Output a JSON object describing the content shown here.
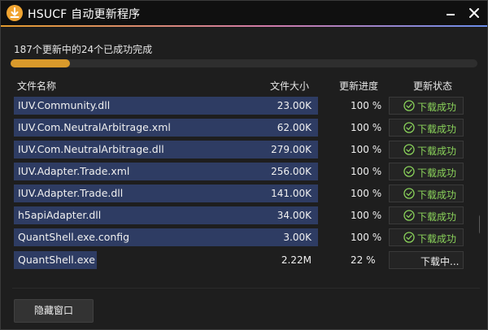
{
  "window": {
    "title": "HSUCF 自动更新程序"
  },
  "summary": {
    "text": "187个更新中的24个已成功完成",
    "progress_fraction": 0.128
  },
  "table": {
    "columns": [
      "文件名称",
      "文件大小",
      "更新进度",
      "更新状态"
    ],
    "rows": [
      {
        "name": "IUV.Community.dll",
        "size": "23.00K",
        "progress": "100 %",
        "status": "下载成功",
        "done": true
      },
      {
        "name": "IUV.Com.NeutralArbitrage.xml",
        "size": "62.00K",
        "progress": "100 %",
        "status": "下载成功",
        "done": true
      },
      {
        "name": "IUV.Com.NeutralArbitrage.dll",
        "size": "279.00K",
        "progress": "100 %",
        "status": "下载成功",
        "done": true
      },
      {
        "name": "IUV.Adapter.Trade.xml",
        "size": "256.00K",
        "progress": "100 %",
        "status": "下载成功",
        "done": true
      },
      {
        "name": "IUV.Adapter.Trade.dll",
        "size": "141.00K",
        "progress": "100 %",
        "status": "下载成功",
        "done": true
      },
      {
        "name": "h5apiAdapter.dll",
        "size": "34.00K",
        "progress": "100 %",
        "status": "下载成功",
        "done": true
      },
      {
        "name": "QuantShell.exe.config",
        "size": "3.00K",
        "progress": "100 %",
        "status": "下载成功",
        "done": true
      },
      {
        "name": "QuantShell.exe",
        "size": "2.22M",
        "progress": "22 %",
        "status": "下载中...",
        "done": false
      }
    ]
  },
  "buttons": {
    "hide_label": "隐藏窗口"
  },
  "colors": {
    "accent": "#f0a431",
    "success": "#8ad25a",
    "row_fill": "#2e3c63"
  },
  "icons": {
    "app": "download-icon",
    "minimize": "minimize-icon",
    "close": "close-icon",
    "status_ok": "check-circle-icon"
  }
}
